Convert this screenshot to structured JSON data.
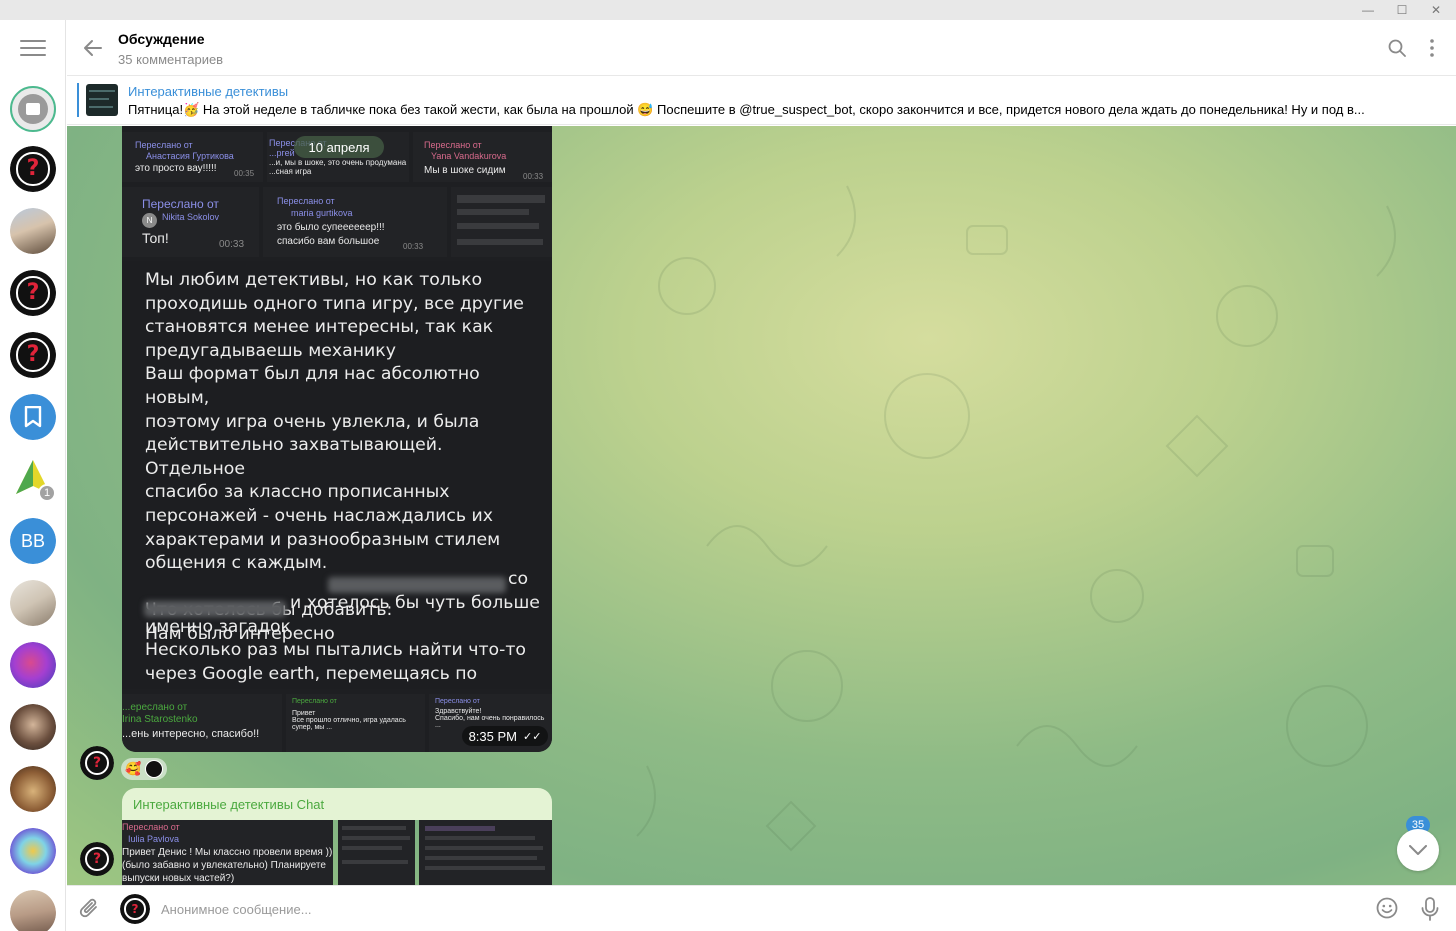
{
  "header": {
    "title": "Обсуждение",
    "subtitle": "35 комментариев"
  },
  "pinned": {
    "channel": "Интерактивные детективы",
    "text": "Пятница!🥳  На этой неделе в табличке пока без такой жести, как была на прошлой 😅  Поспешите в  @true_suspect_bot, скоро закончится и все, придется нового дела ждать до понедельника!   Ну и под в..."
  },
  "sidebar": {
    "folder_badge": "1",
    "initials": "BB"
  },
  "album": {
    "date": "10 апреля",
    "tiles": [
      {
        "label": "Переслано от",
        "name": "Анастасия Гуртикова",
        "text": "это просто вау!!!!!",
        "time": "00:35"
      },
      {
        "label": "Переслано от",
        "name": "...ргей",
        "text": "...и, мы в шоке, это очень продумана ...сная игра",
        "time": ""
      },
      {
        "label": "Переслано от",
        "name": "Yana Vandakurova",
        "text": "Мы в шоке сидим",
        "time": "00:33"
      },
      {
        "label": "Переслано от",
        "name": "Nikita Sokolov",
        "text": "Топ!",
        "time": "00:33"
      },
      {
        "label": "Переслано от",
        "name": "maria gurtikova",
        "text": "это было супеееееер!!! спасибо вам большое",
        "time": "00:33"
      },
      {
        "label": "",
        "name": "",
        "text": "",
        "time": ""
      }
    ],
    "review_text": "Мы любим детективы, но как только\nпроходишь одного типа игру, все другие\nстановятся менее интересны, так как\nпредугадываешь механику\nВаш формат был для нас абсолютно новым,\nпоэтому игра очень увлекла,  и была\nдействительно захватывающей. Отдельное\nспасибо за классно прописанных\nперсонажей - очень наслаждались их\nхарактерами и разнообразным стилем\nобщения с каждым.\n\nЧто хотелось бы добавить:\nНам было интересно",
    "review_tail": "со",
    "review_tail2": "и хотелось бы чуть больше\nименно загадок\nНесколько раз мы пытались найти что-то\nчерез Google earth, перемещаясь по улицам",
    "bottom_tiles": [
      {
        "label": "...ереслано от",
        "name": "Irina Starostenko",
        "text": "...ень интересно, спасибо!!"
      },
      {
        "label": "Переслано от",
        "name": "",
        "text": "Привет\nВсе прошло отлично, игра удалась супер, мы ..."
      },
      {
        "label": "Переслано от",
        "name": "",
        "text": "Здравствуйте!\nСпасибо, нам очень понравилось ..."
      }
    ],
    "time": "8:35 PM",
    "reaction_emoji": "🥰"
  },
  "album2": {
    "title": "Интерактивные детективы Chat",
    "tile": {
      "label": "Переслано от",
      "name": "Iulia Pavlova",
      "text": "Привет Денис ! Мы классно провели время ))\n(было забавно и увлекательно) Планируете\nвыпуски новых частей?)"
    }
  },
  "scroll": {
    "count": "35"
  },
  "composer": {
    "placeholder": "Анонимное сообщение..."
  },
  "colors": {
    "accent": "#3a8fd8",
    "link_green": "#4ba93f",
    "forward_name": "#8b8fe8"
  }
}
